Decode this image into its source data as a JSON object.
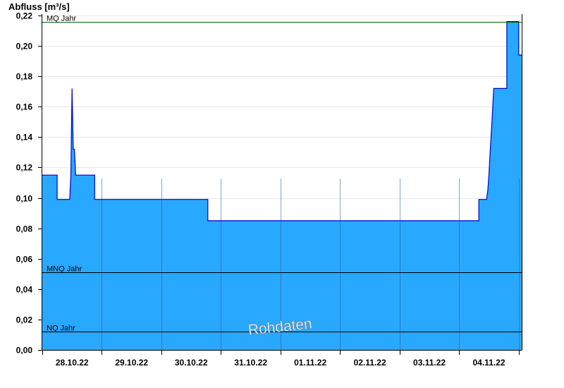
{
  "chart_data": {
    "type": "area",
    "ylabel": "Abfluss [m³/s]",
    "ylim": [
      0,
      0.22
    ],
    "y_ticks": [
      "0,00",
      "0,02",
      "0,04",
      "0,06",
      "0,08",
      "0,10",
      "0,12",
      "0,14",
      "0,16",
      "0,18",
      "0,20",
      "0,22"
    ],
    "x_ticks": [
      "28.10.22",
      "29.10.22",
      "30.10.22",
      "31.10.22",
      "01.11.22",
      "02.11.22",
      "03.11.22",
      "04.11.22"
    ],
    "x_unit": "days since 28.10.22 00:00",
    "xlim": [
      -0.5,
      7.55
    ],
    "grid": true,
    "series": [
      {
        "name": "Abfluss",
        "color_fill": "#29a8ff",
        "color_line": "#0000cc",
        "points": [
          [
            -0.5,
            0.115
          ],
          [
            -0.25,
            0.115
          ],
          [
            -0.25,
            0.099
          ],
          [
            -0.04,
            0.099
          ],
          [
            -0.02,
            0.115
          ],
          [
            0.0,
            0.172
          ],
          [
            0.02,
            0.132
          ],
          [
            0.04,
            0.132
          ],
          [
            0.06,
            0.115
          ],
          [
            0.38,
            0.115
          ],
          [
            0.38,
            0.099
          ],
          [
            2.28,
            0.099
          ],
          [
            2.28,
            0.085
          ],
          [
            6.83,
            0.085
          ],
          [
            6.83,
            0.099
          ],
          [
            6.96,
            0.099
          ],
          [
            6.98,
            0.105
          ],
          [
            7.0,
            0.115
          ],
          [
            7.02,
            0.13
          ],
          [
            7.05,
            0.15
          ],
          [
            7.08,
            0.172
          ],
          [
            7.3,
            0.172
          ],
          [
            7.3,
            0.216
          ],
          [
            7.5,
            0.216
          ],
          [
            7.5,
            0.194
          ],
          [
            7.55,
            0.194
          ]
        ]
      }
    ],
    "reference_lines": [
      {
        "label": "MQ Jahr",
        "value": 0.216,
        "color": "#006600"
      },
      {
        "label": "MNQ Jahr",
        "value": 0.051,
        "color": "#000000"
      },
      {
        "label": "NQ Jahr",
        "value": 0.012,
        "color": "#000000"
      }
    ],
    "watermark": "Rohdaten"
  }
}
